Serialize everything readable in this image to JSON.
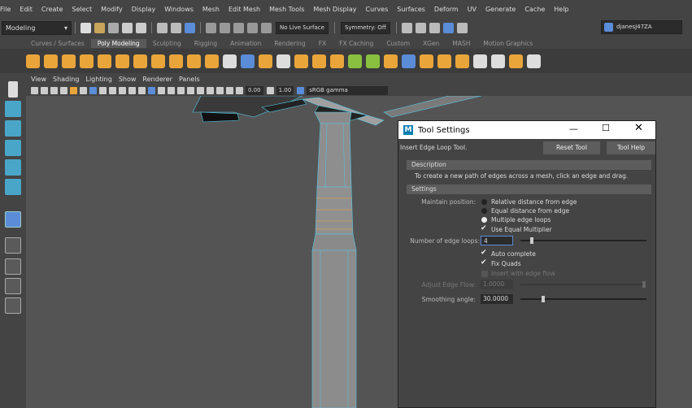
{
  "menubar": [
    "File",
    "Edit",
    "Create",
    "Select",
    "Modify",
    "Display",
    "Windows",
    "Mesh",
    "Edit Mesh",
    "Mesh Tools",
    "Mesh Display",
    "Curves",
    "Surfaces",
    "Deform",
    "UV",
    "Generate",
    "Cache",
    "Help"
  ],
  "status": {
    "mode": "Modeling",
    "live_surface": "No Live Surface",
    "symmetry": "Symmetry: Off",
    "user": "djanesJ47ZA"
  },
  "shelf_tabs": [
    "Curves / Surfaces",
    "Poly Modeling",
    "Sculpting",
    "Rigging",
    "Animation",
    "Rendering",
    "FX",
    "FX Caching",
    "Custom",
    "XGen",
    "MASH",
    "Motion Graphics"
  ],
  "shelf_active": "Poly Modeling",
  "panel_menu": [
    "View",
    "Shading",
    "Lighting",
    "Show",
    "Renderer",
    "Panels"
  ],
  "panel_bar": {
    "value1": "0.00",
    "value2": "1.00",
    "color_space": "sRGB gamma"
  },
  "tool_settings": {
    "title": "Tool Settings",
    "tool_name": "Insert Edge Loop Tool.",
    "reset_button": "Reset Tool",
    "help_button": "Tool Help",
    "description_header": "Description",
    "description_text": "To create a new path of edges across a mesh, click an edge and drag.",
    "settings_header": "Settings",
    "maintain_label": "Maintain position:",
    "options": [
      "Relative distance from edge",
      "Equal distance from edge",
      "Multiple edge loops"
    ],
    "use_equal_multiplier": "Use Equal Multiplier",
    "num_loops_label": "Number of edge loops:",
    "num_loops_value": "4",
    "num_loops_fraction": 0.08,
    "auto_complete": "Auto complete",
    "fix_quads": "Fix Quads",
    "insert_edge_flow": "Insert with edge flow",
    "adjust_edge_flow_label": "Adjust Edge Flow:",
    "adjust_edge_flow_value": "1.0000",
    "smoothing_label": "Smoothing angle:",
    "smoothing_value": "30.0000",
    "smoothing_fraction": 0.17
  },
  "colors": {
    "accent_blue": "#5a8cd8",
    "maya_logo": "#0d7fb3",
    "wire_cyan": "#53c8e8"
  }
}
